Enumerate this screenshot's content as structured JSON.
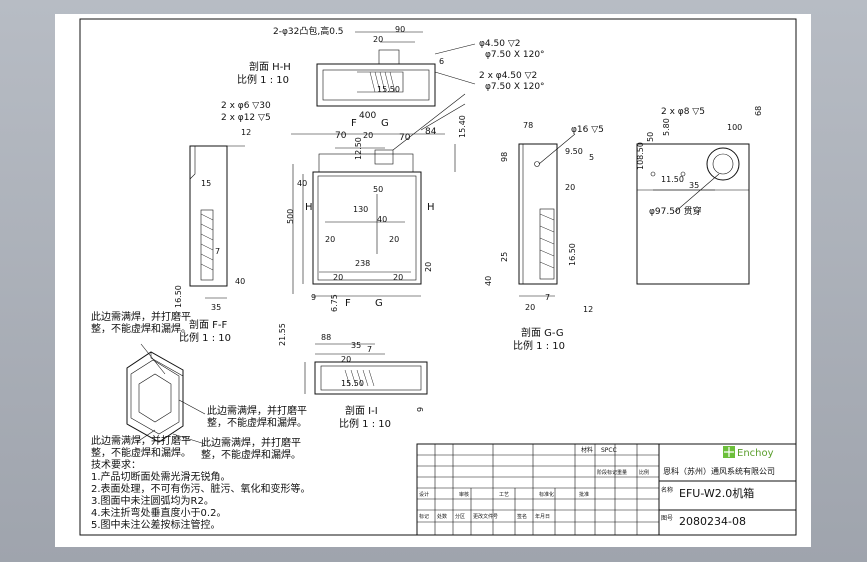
{
  "drawing": {
    "top_dims": {
      "d1": "2-φ32凸包,高0.5",
      "d2": "90",
      "d3": "20",
      "d4": "φ4.50 ▽2",
      "d5": "φ7.50 X 120°",
      "d6": "2 x φ4.50 ▽2",
      "d7": "φ7.50 X 120°",
      "d8": "15.50",
      "d9": "6"
    },
    "left_dims": {
      "d1": "2 x φ6 ▽30",
      "d2": "2 x φ12 ▽5",
      "d3": "12",
      "d4": "15",
      "d5": "7",
      "d6": "16.50",
      "d7": "35",
      "d8": "40"
    },
    "front_dims": {
      "d1": "400",
      "d2": "70",
      "d3": "20",
      "d4": "84",
      "d5": "70",
      "d6": "15.40",
      "d7": "40",
      "d8": "12.50",
      "d9": "130",
      "d10": "40",
      "d11": "500",
      "d12": "20",
      "d13": "20",
      "d14": "238",
      "d15": "9",
      "d16": "6.75",
      "d17": "20",
      "d18": "50",
      "d19": "20",
      "d20": "20"
    },
    "right_dims": {
      "d1": "78",
      "d2": "φ16 ▽5",
      "d3": "98",
      "d4": "9.50",
      "d5": "5",
      "d6": "20",
      "d7": "25",
      "d8": "40",
      "d9": "16.50",
      "d10": "20",
      "d11": "7",
      "d12": "12"
    },
    "far_dims": {
      "d1": "2 x φ8 ▽5",
      "d2": "100",
      "d3": "68",
      "d4": "5.80",
      "d5": "108.50",
      "d6": "11.50",
      "d7": "35",
      "d8": "φ97.50 贯穿",
      "d9": "50"
    },
    "bottom_dims": {
      "d1": "21.55",
      "d2": "88",
      "d3": "35",
      "d4": "7",
      "d5": "20",
      "d6": "15.50",
      "d7": "9"
    },
    "section_labels": {
      "hh_name": "剖面 H-H",
      "hh_scale": "比例 1 : 10",
      "ff_name": "剖面 F-F",
      "ff_scale": "比例 1 : 10",
      "gg_name": "剖面 G-G",
      "gg_scale": "比例 1 : 10",
      "ii_name": "剖面 I-I",
      "ii_scale": "比例 1 : 10"
    },
    "cut_letters": {
      "f": "F",
      "g": "G",
      "h": "H"
    },
    "notes": {
      "n1": "此边需满焊，并打磨平",
      "n2": "整，不能虚焊和漏焊。",
      "n3": "此边需满焊，并打磨平",
      "n4": "整，不能虚焊和漏焊。",
      "n5": "此边需满焊，并打磨平",
      "n6": "整，不能虚焊和漏焊。",
      "n7": "此边需满焊，并打磨平",
      "n8": "整，不能虚焊和漏焊。",
      "tr_title": "技术要求：",
      "tr1": "1.产品切断面处需光滑无锐角。",
      "tr2": "2.表面处理，不可有伤污、脏污、氧化和变形等。",
      "tr3": "3.图面中未注圆弧均为R2。",
      "tr4": "4.未注折弯处垂直度小于0.2。",
      "tr5": "5.图中未注公差按标注管控。"
    },
    "title_block": {
      "company_logo": "Enchoy",
      "company": "恩科（苏州）通风系统有限公司",
      "name_label": "名称",
      "part_name": "EFU-W2.0机箱",
      "drawing_no_label": "图号",
      "drawing_no": "2080234-08",
      "col_labels": [
        "标记",
        "处数",
        "分区",
        "更改文件号",
        "签名",
        "年月日"
      ],
      "material_label": "材料",
      "material": "SPCC",
      "sig_labels": [
        "设计",
        "审核",
        "工艺",
        "标准化",
        "批准"
      ],
      "scale_row": [
        "阶段标记",
        "重量",
        "比例"
      ]
    }
  }
}
